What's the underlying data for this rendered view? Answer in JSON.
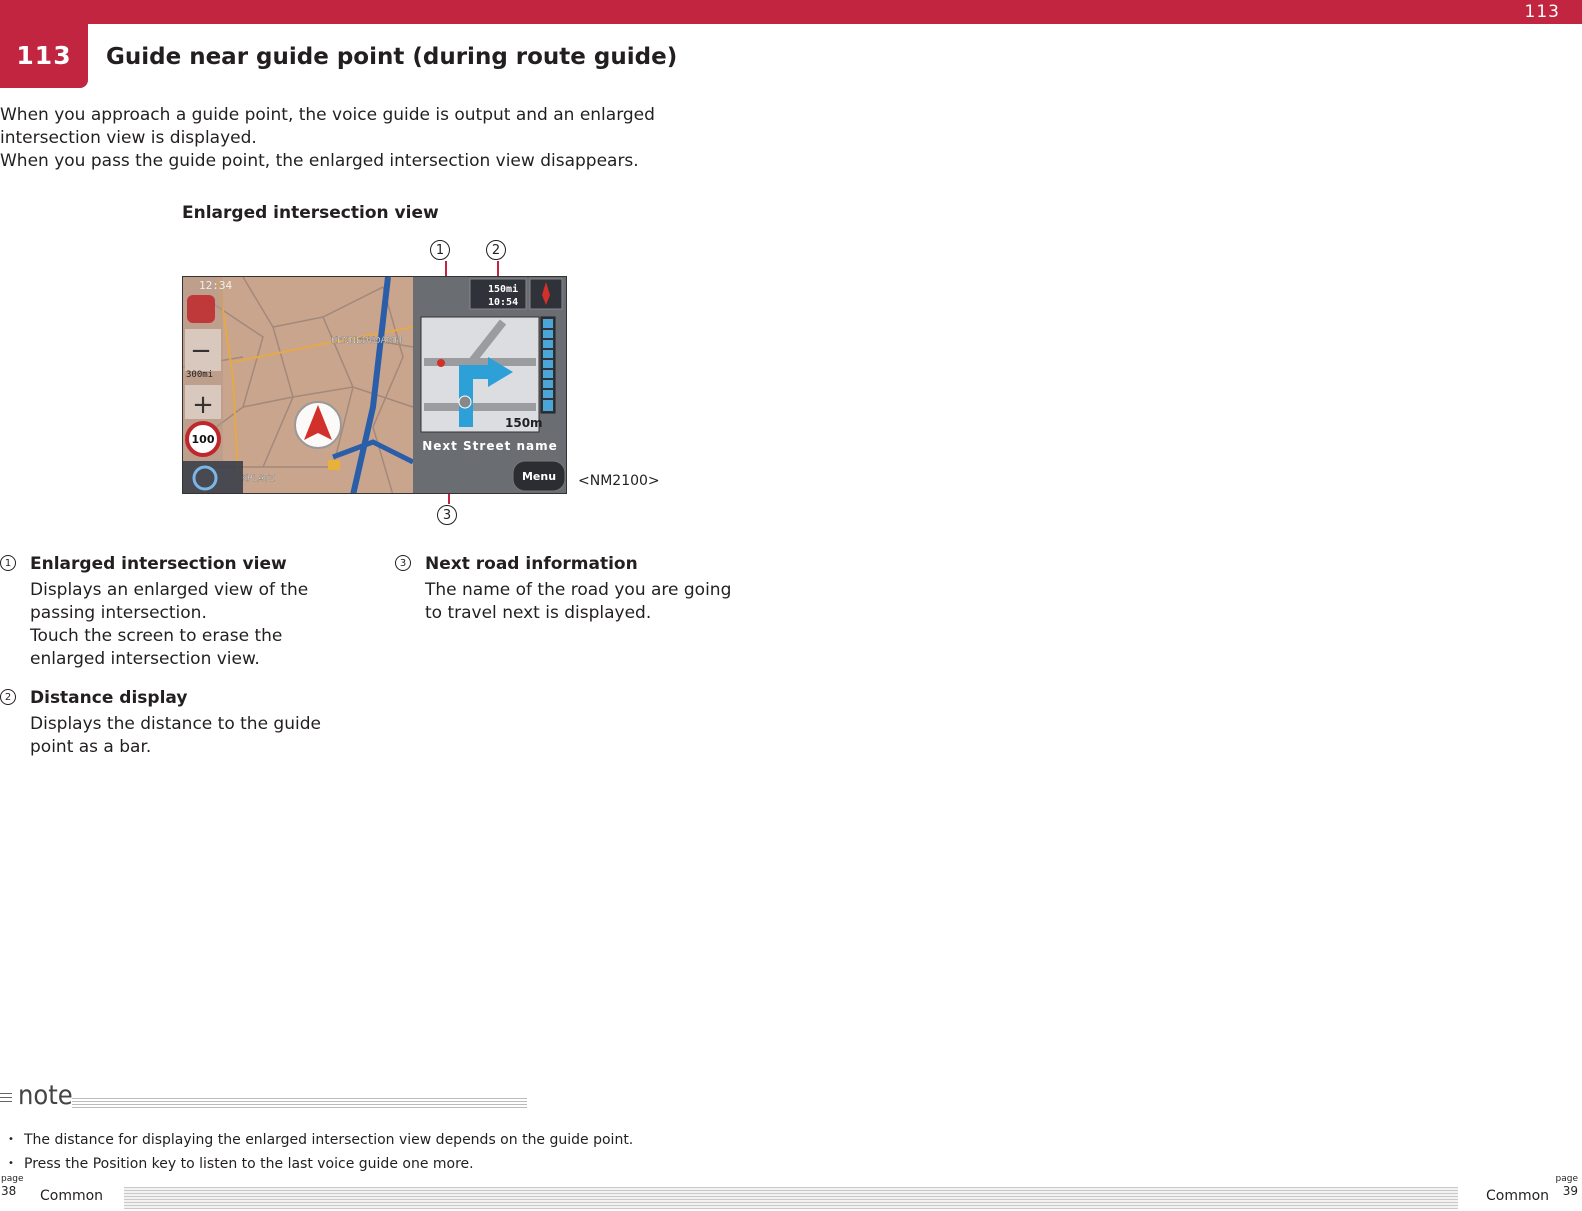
{
  "header": {
    "page_number_top": "113",
    "tab_number": "113",
    "title": "Guide near guide point (during route guide)"
  },
  "intro": {
    "line1": "When you approach a guide point, the voice guide is output and an enlarged intersection view is displayed.",
    "line2": "When you pass the guide point, the enlarged intersection view disappears."
  },
  "figure": {
    "caption": "Enlarged intersection view",
    "model": "<NM2100>",
    "callouts": [
      "1",
      "2",
      "3"
    ],
    "screen": {
      "time": "12:34",
      "scale": "300mi",
      "speed_limit": "100",
      "street_top": "KENNEDYDAMM",
      "street_bottom": "CKPLATZ",
      "distance_remaining": "150mi",
      "arrival_time": "10:54",
      "turn_distance": "150m",
      "next_street": "Next Street name",
      "menu_label": "Menu",
      "distance_bar_fraction": 1.0
    }
  },
  "descriptions": [
    {
      "num": "1",
      "heading": "Enlarged intersection view",
      "body1": "Displays an enlarged view of the passing intersection.",
      "body2": "Touch the screen to erase the enlarged intersection view."
    },
    {
      "num": "2",
      "heading": "Distance display",
      "body1": "Displays the distance to the guide point as a bar."
    },
    {
      "num": "3",
      "heading": "Next road information",
      "body1": "The name of the road you are going to travel next is displayed."
    }
  ],
  "note": {
    "label": "note",
    "items": [
      "The distance for displaying the enlarged intersection view depends on the guide point.",
      "Press the Position key to listen to the last voice guide one more."
    ]
  },
  "footer": {
    "left_page_label": "page",
    "left_page_num": "38",
    "left_text": "Common",
    "right_page_label": "page",
    "right_page_num": "39",
    "right_text": "Common"
  },
  "colors": {
    "accent": "#c1253f",
    "map_bg": "#c9a58e",
    "route": "#2a5ea8"
  }
}
